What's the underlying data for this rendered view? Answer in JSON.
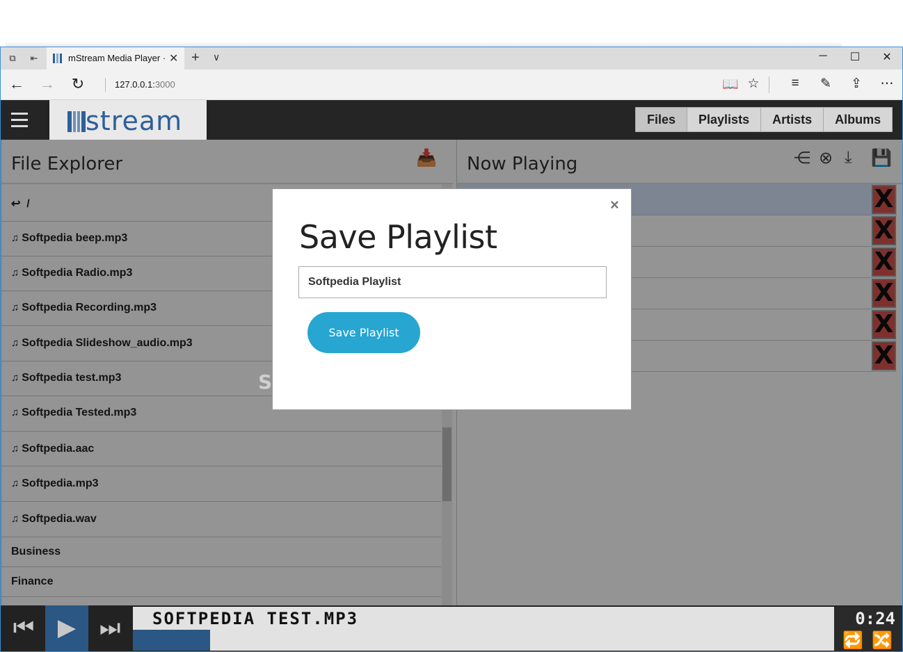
{
  "browser": {
    "tab_title": "mStream Media Player ·",
    "address_host": "127.0.0.1:",
    "address_port": "3000"
  },
  "app": {
    "logo_text": "stream",
    "nav_tabs": [
      "Files",
      "Playlists",
      "Artists",
      "Albums"
    ]
  },
  "file_explorer": {
    "title": "File Explorer",
    "back_path": "/",
    "files": [
      "Softpedia beep.mp3",
      "Softpedia Radio.mp3",
      "Softpedia Recording.mp3",
      "Softpedia Slideshow_audio.mp3",
      "Softpedia test.mp3",
      "Softpedia Tested.mp3",
      "Softpedia.aac",
      "Softpedia.mp3",
      "Softpedia.wav"
    ],
    "folders": [
      "Business",
      "Finance"
    ]
  },
  "now_playing": {
    "title": "Now Playing",
    "queue_count": 6,
    "remove_label": "X"
  },
  "player": {
    "track": "SOFTPEDIA TEST.MP3",
    "time": "0:24",
    "progress_fraction": 0.11
  },
  "modal": {
    "title": "Save Playlist",
    "input_value": "Softpedia Playlist",
    "button_label": "Save Playlist",
    "close": "×"
  },
  "watermark": "SOFTPEDIA"
}
